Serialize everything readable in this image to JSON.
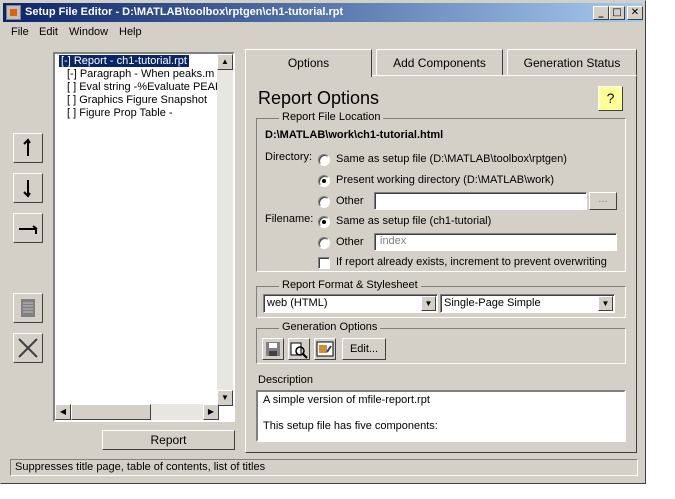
{
  "window": {
    "title": "Setup File Editor - D:\\MATLAB\\toolbox\\rptgen\\ch1-tutorial.rpt",
    "minimize": "_",
    "maximize": "□",
    "close": "✕"
  },
  "menu": [
    "File",
    "Edit",
    "Window",
    "Help"
  ],
  "tree": {
    "items": [
      "[-] Report - ch1-tutorial.rpt",
      "[-] Paragraph - When peaks.m r",
      "[ ] Eval string -%Evaluate PEAK",
      "[ ] Graphics Figure Snapshot",
      "[ ] Figure Prop Table -"
    ]
  },
  "report_button": "Report",
  "tabs": [
    "Options",
    "Add Components",
    "Generation Status"
  ],
  "panel": {
    "title": "Report Options",
    "help": "?",
    "file_location": {
      "legend": "Report File Location",
      "path": "D:\\MATLAB\\work\\ch1-tutorial.html",
      "directory_label": "Directory:",
      "dir_options": [
        "Same as setup file (D:\\MATLAB\\toolbox\\rptgen)",
        "Present working directory (D:\\MATLAB\\work)",
        "Other"
      ],
      "dir_selected": 1,
      "browse": "...",
      "filename_label": "Filename:",
      "file_options": [
        "Same as setup file (ch1-tutorial)",
        "Other"
      ],
      "file_selected": 0,
      "filename_placeholder": "index",
      "increment_label": "If report already exists, increment to prevent overwriting"
    },
    "format": {
      "legend": "Report Format & Stylesheet",
      "format_value": "web (HTML)",
      "stylesheet_value": "Single-Page Simple"
    },
    "generation": {
      "legend": "Generation Options",
      "icons": [
        "save-icon",
        "preview-icon",
        "image-options-icon"
      ],
      "edit": "Edit..."
    },
    "description": {
      "label": "Description",
      "lines": [
        "A simple version of mfile-report.rpt",
        "This setup file has five components:"
      ]
    }
  },
  "status": "Suppresses title page, table of contents, list of titles"
}
